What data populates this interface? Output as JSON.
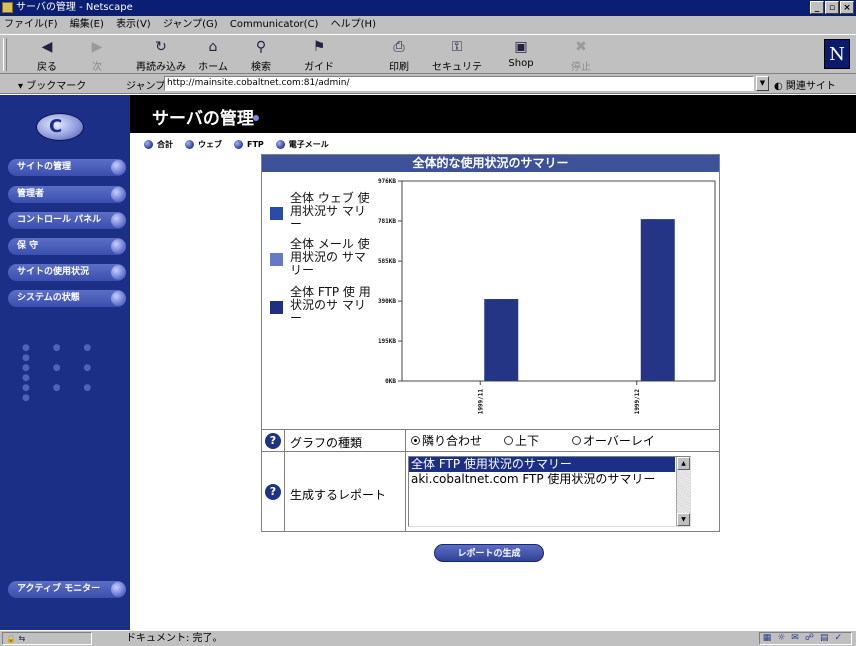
{
  "window": {
    "title": "サーバの管理 - Netscape",
    "controls": [
      "_",
      "▫",
      "×"
    ]
  },
  "menu": [
    "ファイル(F)",
    "編集(E)",
    "表示(V)",
    "ジャンプ(G)",
    "Communicator(C)",
    "ヘルプ(H)"
  ],
  "toolbar": {
    "buttons": [
      {
        "label": "戻る",
        "icon": "back-arrow-icon",
        "glyph": "◀",
        "enabled": true
      },
      {
        "label": "次",
        "icon": "forward-arrow-icon",
        "glyph": "▶",
        "enabled": false
      },
      {
        "label": "再読み込み",
        "icon": "reload-icon",
        "glyph": "↻",
        "enabled": true
      },
      {
        "label": "ホーム",
        "icon": "home-icon",
        "glyph": "⌂",
        "enabled": true
      },
      {
        "label": "検索",
        "icon": "search-icon",
        "glyph": "⚲",
        "enabled": true
      },
      {
        "label": "ガイド",
        "icon": "guide-icon",
        "glyph": "⚑",
        "enabled": true
      },
      {
        "label": "印刷",
        "icon": "print-icon",
        "glyph": "⎙",
        "enabled": true
      },
      {
        "label": "セキュリティ",
        "icon": "security-lock-icon",
        "glyph": "⚿",
        "enabled": true
      },
      {
        "label": "Shop",
        "icon": "shop-icon",
        "glyph": "▣",
        "enabled": true
      },
      {
        "label": "停止",
        "icon": "stop-icon",
        "glyph": "✖",
        "enabled": false
      }
    ],
    "logo_letter": "N"
  },
  "location": {
    "bookmarks_label": "ブックマーク",
    "jump_label": "ジャンプ:",
    "url": "http://mainsite.cobaltnet.com:81/admin/",
    "related_label": "関連サイト"
  },
  "page": {
    "title": "サーバの管理",
    "logo_letter": "C",
    "subtabs": [
      "合計",
      "ウェブ",
      "FTP",
      "電子メール"
    ],
    "sidebar": [
      "サイトの管理",
      "管理者",
      "コントロール パネル",
      "保 守",
      "サイトの使用状況",
      "システムの状態"
    ],
    "monitor_label": "アクティブ モニター",
    "panel_title": "全体的な使用状況のサマリー",
    "legend": [
      {
        "label": "全体 ウェブ 使用状況サ マリー",
        "color": "#2c4aa8"
      },
      {
        "label": "全体 メール 使用状況の サマリー",
        "color": "#6678c8"
      },
      {
        "label": "全体 FTP 使 用状況のサ マリー",
        "color": "#1f2f82"
      }
    ],
    "graph_type": {
      "label": "グラフの種類",
      "options": [
        "隣り合わせ",
        "上下",
        "オーバーレイ"
      ],
      "selected": "隣り合わせ"
    },
    "report": {
      "label": "生成するレポート",
      "options": [
        "全体 FTP 使用状況のサマリー",
        "aki.cobaltnet.com FTP 使用状況のサマリー"
      ],
      "selected": "全体 FTP 使用状況のサマリー"
    },
    "generate_button": "レポートの生成"
  },
  "status": {
    "text": "ドキュメント: 完了。",
    "indicator_icons": [
      "security-icon",
      "component-bar-icon"
    ],
    "tray_icons": [
      "navigator-icon",
      "mail-icon",
      "discussion-icon",
      "composer-icon",
      "check-icon"
    ]
  },
  "chart_data": {
    "type": "bar",
    "categories": [
      "1999/11",
      "1999/12"
    ],
    "series": [
      {
        "name": "全体 FTP 使用状況のサマリー",
        "values": [
          400,
          790
        ],
        "color": "#233584"
      }
    ],
    "ylabel": "",
    "y_ticks": [
      "0KB",
      "195KB",
      "390KB",
      "585KB",
      "781KB",
      "976KB"
    ],
    "y_tick_values": [
      0,
      195,
      390,
      585,
      781,
      976
    ],
    "ylim": [
      0,
      976
    ],
    "grid": false,
    "legend_position": "left"
  }
}
